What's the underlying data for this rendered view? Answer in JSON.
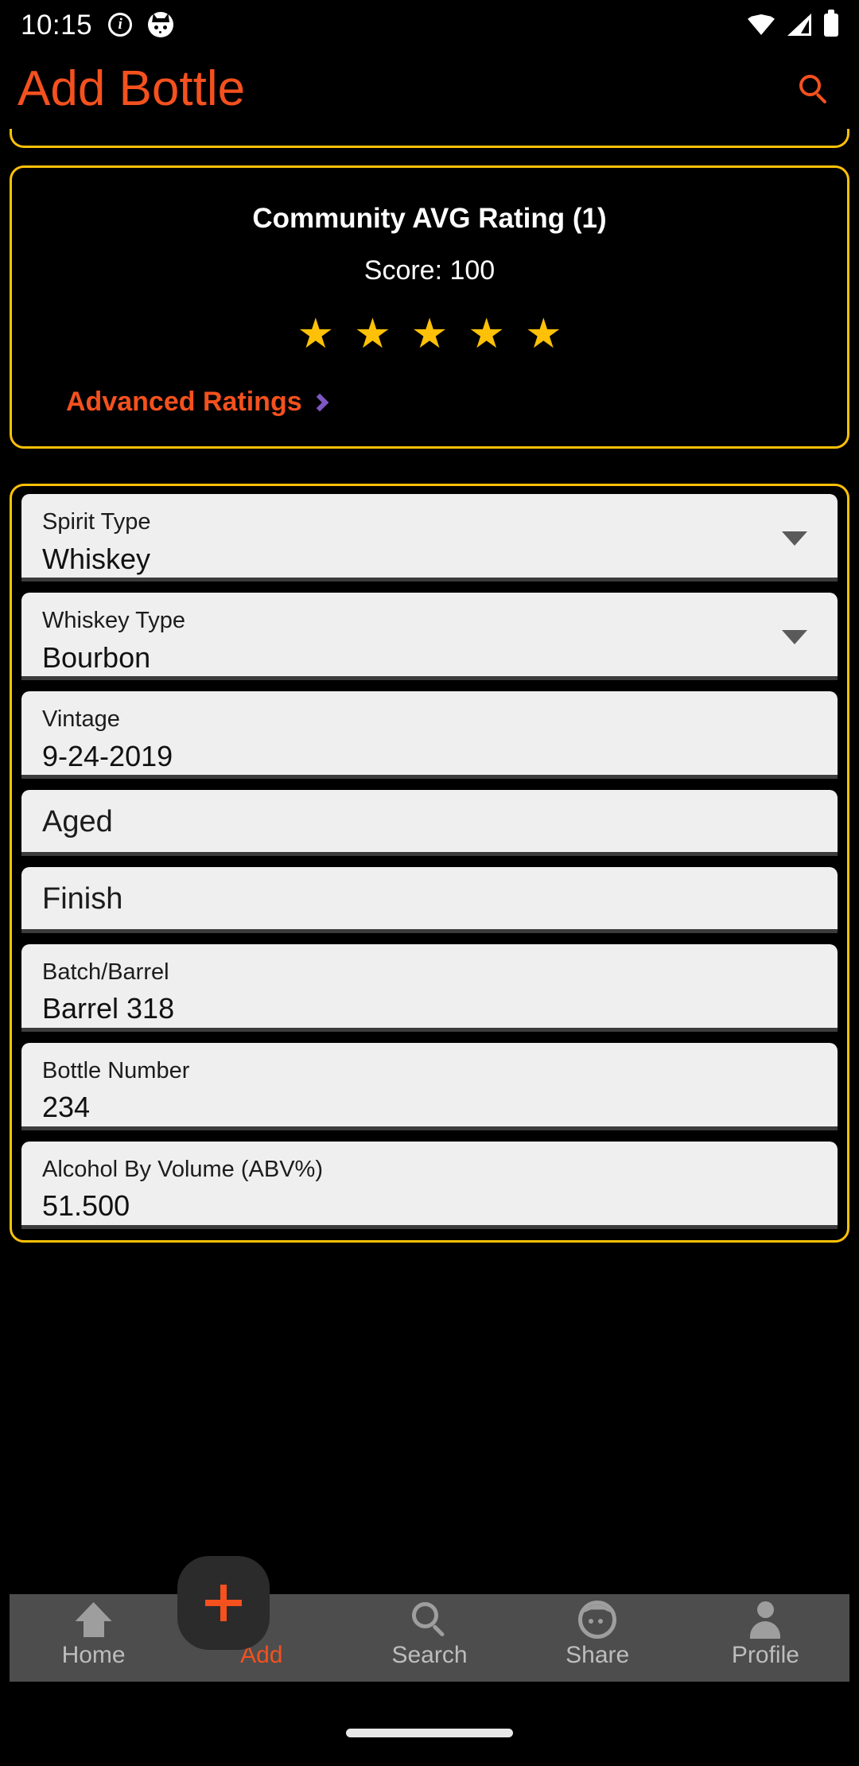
{
  "status_bar": {
    "time": "10:15",
    "icons_left": [
      "info-icon",
      "face-icon"
    ],
    "icons_right": [
      "wifi-icon",
      "cellular-signal-icon",
      "battery-icon"
    ]
  },
  "app_bar": {
    "title": "Add Bottle",
    "search_icon": "search-icon",
    "title_color": "#F4511E"
  },
  "rating_card": {
    "title": "Community AVG Rating (1)",
    "score": "Score: 100",
    "stars_filled": 5,
    "stars_total": 5,
    "star_color": "#FFC107",
    "advanced_link": "Advanced Ratings",
    "advanced_chevron_icon": "chevron-right-icon",
    "link_color": "#F4511E",
    "chevron_color": "#7E57C2",
    "border_color": "#FFC107"
  },
  "form": {
    "border_color": "#FFC107",
    "fields": [
      {
        "label": "Spirit Type",
        "value": "Whiskey",
        "type": "dropdown",
        "has_caret": true
      },
      {
        "label": "Whiskey Type",
        "value": "Bourbon",
        "type": "dropdown",
        "has_caret": true
      },
      {
        "label": "Vintage",
        "value": "9-24-2019",
        "type": "text",
        "has_caret": false
      },
      {
        "label": "Aged",
        "value": "",
        "type": "text",
        "has_caret": false
      },
      {
        "label": "Finish",
        "value": "",
        "type": "text",
        "has_caret": false
      },
      {
        "label": "Batch/Barrel",
        "value": "Barrel 318",
        "type": "text",
        "has_caret": false
      },
      {
        "label": "Bottle Number",
        "value": "234",
        "type": "text",
        "has_caret": false
      },
      {
        "label": "Alcohol By Volume (ABV%)",
        "value": "51.500",
        "type": "text",
        "has_caret": false
      }
    ]
  },
  "bottom_nav": {
    "active": "Add",
    "active_color": "#F4511E",
    "items": [
      {
        "label": "Home",
        "icon": "home-icon"
      },
      {
        "label": "Add",
        "icon": "plus-icon"
      },
      {
        "label": "Search",
        "icon": "search-icon"
      },
      {
        "label": "Share",
        "icon": "share-face-icon"
      },
      {
        "label": "Profile",
        "icon": "person-icon"
      }
    ]
  }
}
